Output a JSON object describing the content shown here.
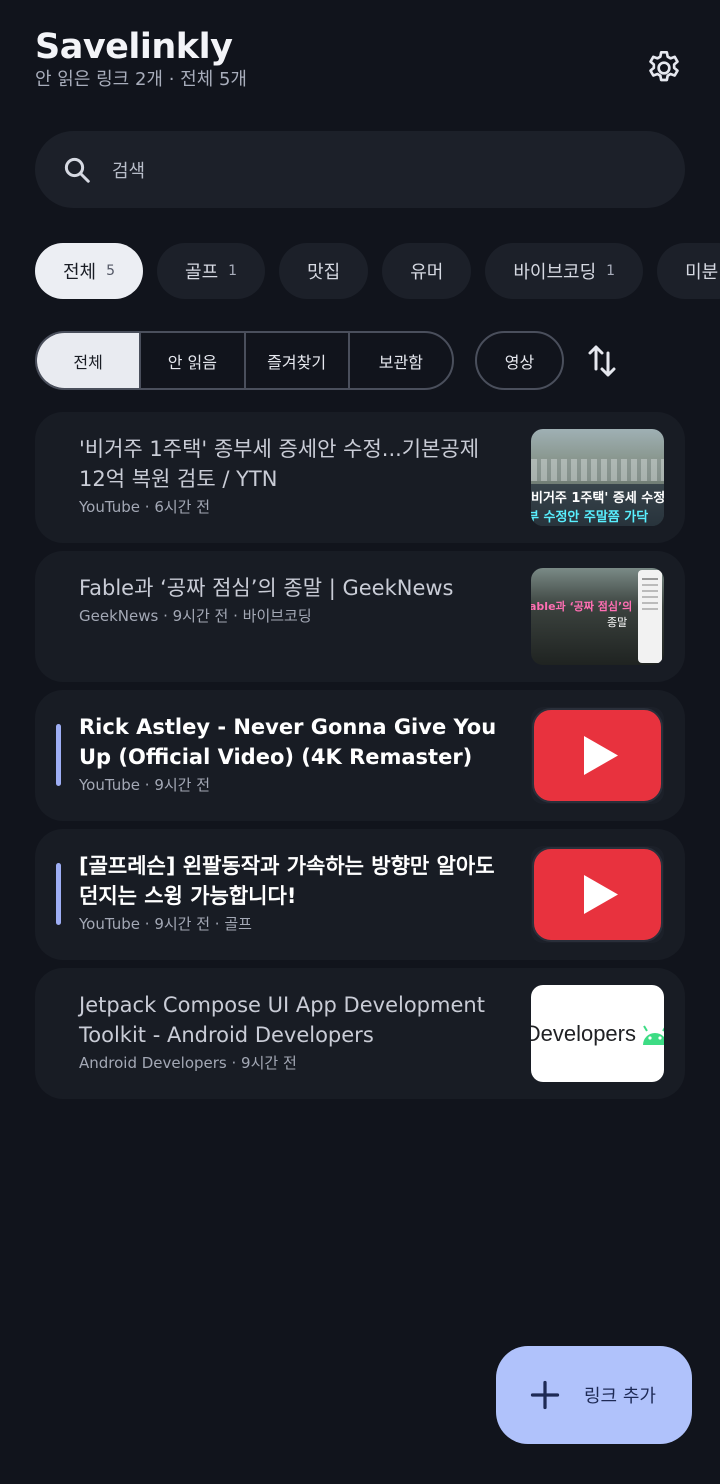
{
  "app": {
    "title": "Savelinkly",
    "subtitle": "안 읽은 링크 2개 · 전체 5개"
  },
  "icons": {
    "settings": "gear-icon",
    "search": "search-icon",
    "sort": "sort-icon",
    "fab": "plus-icon"
  },
  "search": {
    "placeholder": "검색"
  },
  "categories": [
    {
      "label": "전체",
      "count": "5"
    },
    {
      "label": "골프",
      "count": "1"
    },
    {
      "label": "맛집",
      "count": ""
    },
    {
      "label": "유머",
      "count": ""
    },
    {
      "label": "바이브코딩",
      "count": "1"
    },
    {
      "label": "미분",
      "count": ""
    }
  ],
  "filters": [
    "전체",
    "안 읽음",
    "즐겨찾기",
    "보관함"
  ],
  "video_filter": "영상",
  "links": [
    {
      "title": "'비거주 1주택' 종부세 증세안 수정...기본공제 12억 복원 검토 / YTN",
      "source": "YouTube",
      "time": "6시간 전",
      "category": "",
      "unread": false,
      "thumb": {
        "type": "news",
        "caption1": "'비거주 1주택' 증세 수정",
        "caption2": "부 수정안 주말쯤 가닥"
      }
    },
    {
      "title": "Fable과 ‘공짜 점심’의 종말 | GeekNews",
      "source": "GeekNews",
      "time": "9시간 전",
      "category": "바이브코딩",
      "unread": false,
      "thumb": {
        "type": "article",
        "caption1": "able과 ‘공짜 점심’의",
        "caption2": "종말"
      }
    },
    {
      "title": "Rick Astley - Never Gonna Give You Up (Official Video) (4K Remaster)",
      "source": "YouTube",
      "time": "9시간 전",
      "category": "",
      "unread": true,
      "thumb": {
        "type": "youtube"
      }
    },
    {
      "title": "[골프레슨] 왼팔동작과 가속하는 방향만 알아도 던지는 스윙 가능합니다!",
      "source": "YouTube",
      "time": "9시간 전",
      "category": "골프",
      "unread": true,
      "thumb": {
        "type": "youtube"
      }
    },
    {
      "title": "Jetpack Compose UI App Development Toolkit - Android Developers",
      "source": "Android Developers",
      "time": "9시간 전",
      "category": "",
      "unread": false,
      "thumb": {
        "type": "android",
        "caption1": "Developers"
      }
    }
  ],
  "fab": {
    "label": "링크 추가"
  },
  "colors": {
    "background": "#11141c",
    "surface": "#181c24",
    "accent": "#b0c2fb",
    "unread_bar": "#9eaef4",
    "youtube_red": "#e8323e"
  }
}
